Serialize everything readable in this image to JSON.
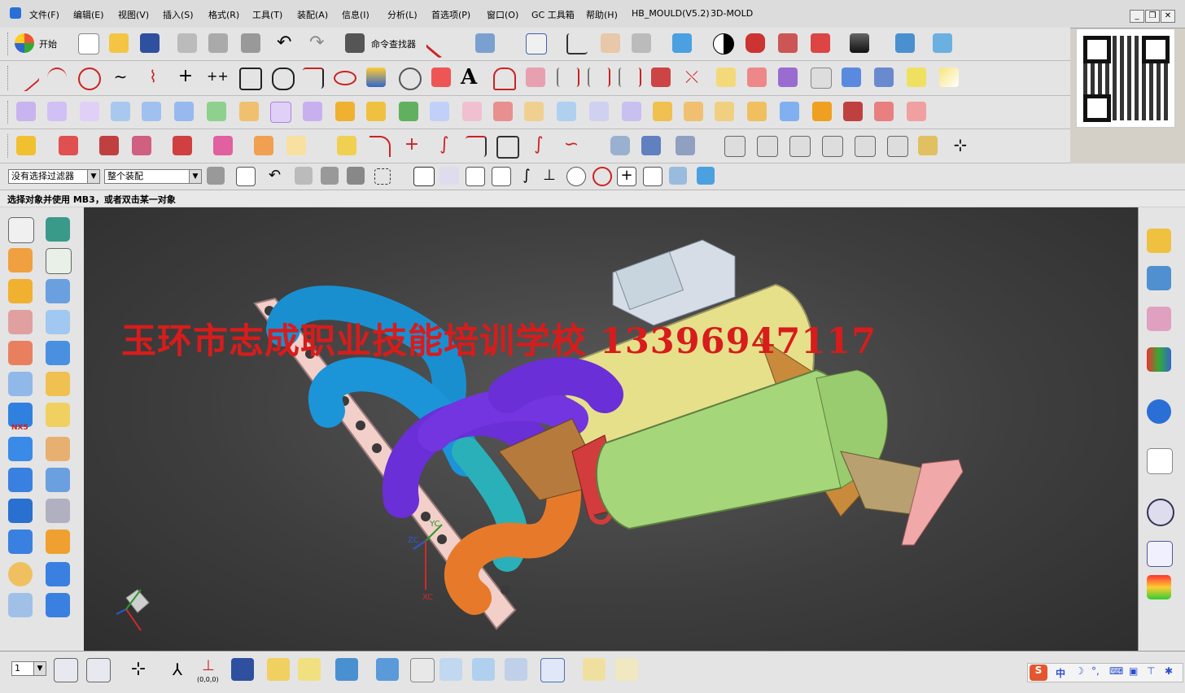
{
  "menu": {
    "items": [
      "文件(F)",
      "编辑(E)",
      "视图(V)",
      "插入(S)",
      "格式(R)",
      "工具(T)",
      "装配(A)",
      "信息(I)",
      "分析(L)",
      "首选项(P)",
      "窗口(O)",
      "GC 工具箱",
      "帮助(H)",
      "HB_MOULD(V5.2)",
      "3D-MOLD"
    ]
  },
  "toolbar": {
    "start_label": "开始",
    "command_finder_label": "命令查找器"
  },
  "selection": {
    "filter_value": "没有选择过滤器",
    "scope_value": "整个装配"
  },
  "cue_line": "选择对象并使用 MB3，或者双击某一对象",
  "viewport": {
    "watermark": "玉环市志成职业技能培训学校 13396947117",
    "wcs_x": "XC",
    "wcs_y": "YC",
    "wcs_z": "ZC"
  },
  "left_panel": {
    "nx_badge": "NX5"
  },
  "bottom": {
    "layer_value": "1",
    "origin_label": "(0,0,0)"
  },
  "ime": {
    "mode": "中"
  },
  "colors": {
    "background_top": "#5a5a5a",
    "background_bottom": "#2e2e2e",
    "watermark": "#d71c1c",
    "manifold_blue": "#1a8fd0",
    "manifold_purple": "#6a2fd6",
    "catalyst_yellow": "#e6e08a",
    "catalyst_green": "#a6d67a",
    "collector_brown": "#b57a3c",
    "flange_pink": "#f2cfc9",
    "orange_pipe": "#e77a2a",
    "red_cone": "#d23c3c"
  }
}
